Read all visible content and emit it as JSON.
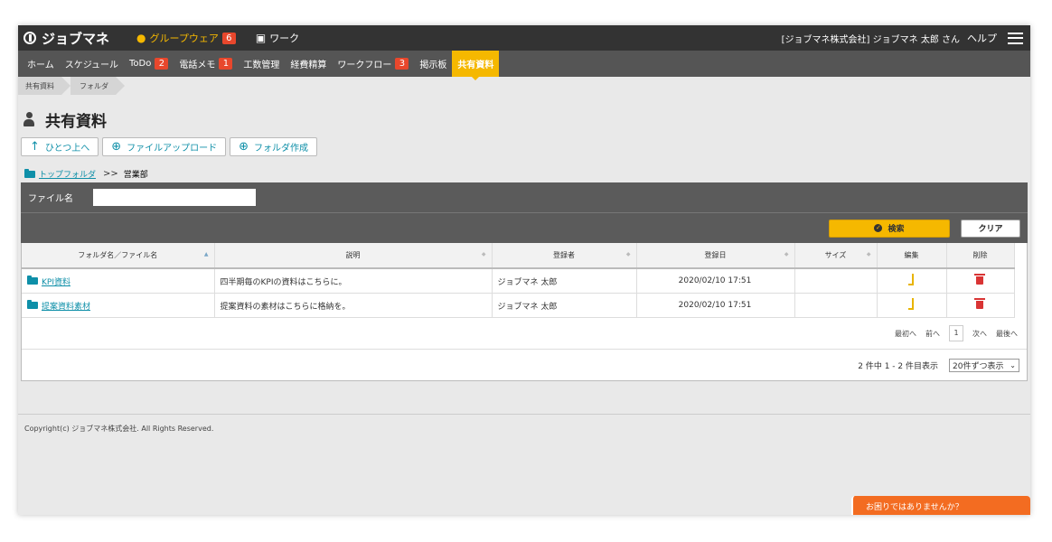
{
  "topbar": {
    "logo": "ジョブマネ",
    "groupware_label": "グループウェア",
    "groupware_count": "6",
    "work_label": "ワーク",
    "company_user": "[ジョブマネ株式会社] ジョブマネ 太郎 さん",
    "help": "ヘルプ"
  },
  "nav": {
    "items": [
      {
        "label": "ホーム"
      },
      {
        "label": "スケジュール"
      },
      {
        "label": "ToDo",
        "badge": "2"
      },
      {
        "label": "電話メモ",
        "badge": "1"
      },
      {
        "label": "工数管理"
      },
      {
        "label": "経費精算"
      },
      {
        "label": "ワークフロー",
        "badge": "3"
      },
      {
        "label": "掲示板"
      },
      {
        "label": "共有資料",
        "active": true
      }
    ]
  },
  "breadcrumb": [
    "共有資料",
    "フォルダ"
  ],
  "page": {
    "title": "共有資料"
  },
  "toolbar": {
    "up_label": "ひとつ上へ",
    "upload_label": "ファイルアップロード",
    "create_folder_label": "フォルダ作成"
  },
  "path": {
    "root": "トップフォルダ",
    "separator": ">>",
    "current": "営業部"
  },
  "search": {
    "label": "ファイル名",
    "value": "",
    "search_label": "検索",
    "clear_label": "クリア"
  },
  "table": {
    "headers": [
      "フォルダ名／ファイル名",
      "説明",
      "登録者",
      "登録日",
      "サイズ",
      "編集",
      "削除"
    ],
    "rows": [
      {
        "name": "KPI資料",
        "desc": "四半期毎のKPIの資料はこちらに。",
        "owner": "ジョブマネ 太郎",
        "date": "2020/02/10 17:51",
        "size": ""
      },
      {
        "name": "提案資料素材",
        "desc": "提案資料の素材はこちらに格納を。",
        "owner": "ジョブマネ 太郎",
        "date": "2020/02/10 17:51",
        "size": ""
      }
    ]
  },
  "pager": {
    "first": "最初へ",
    "prev": "前へ",
    "current": "1",
    "next": "次へ",
    "last": "最後へ"
  },
  "count": {
    "text": "2 件中 1 - 2 件目表示",
    "per_page": "20件ずつ表示"
  },
  "footer": {
    "copyright": "Copyright(c) ジョブマネ株式会社. All Rights Reserved.",
    "help_prompt": "お困りではありませんか？"
  },
  "colors": {
    "accent": "#f5b800",
    "link": "#0e8fa8",
    "badge": "#e8472c",
    "help": "#f36c21"
  }
}
